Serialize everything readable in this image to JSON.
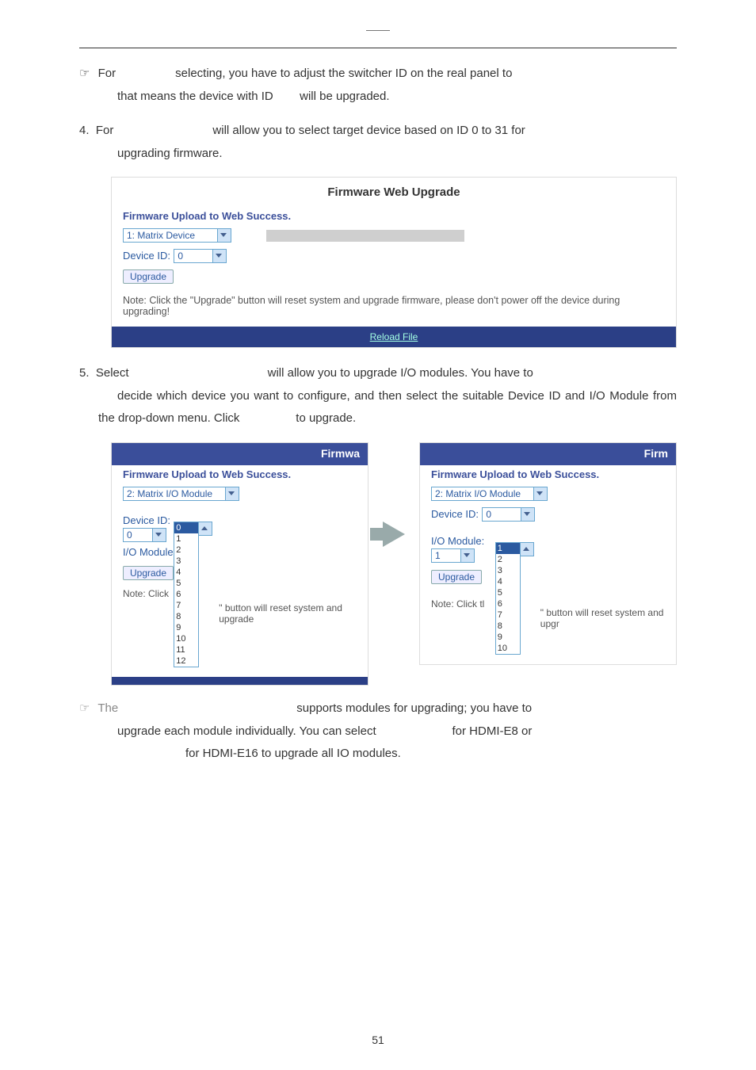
{
  "para1": {
    "hand": "☞",
    "lead": "For",
    "body": "selecting, you have to adjust the switcher ID on the real panel to",
    "line2_a": "that means the device with ID",
    "line2_b": "will be upgraded."
  },
  "item4": {
    "num": "4.",
    "lead": "For",
    "body": "will allow you to select target device based on ID 0 to 31 for",
    "line2": "upgrading firmware."
  },
  "panel1": {
    "title": "Firmware Web Upgrade",
    "success": "Firmware Upload to Web Success.",
    "select": "1: Matrix Device",
    "devLabel": "Device ID:",
    "devVal": "0",
    "upgrade": "Upgrade",
    "note": "Note: Click the \"Upgrade\" button will reset system and upgrade firmware, please don't power off the device during upgrading!",
    "reload": "Reload File"
  },
  "item5": {
    "num": "5.",
    "lead": "Select",
    "body": "will allow you to upgrade I/O modules. You have to",
    "line2": "decide which device you want to configure, and then select the suitable Device ID and I/O Module from the drop-down menu. Click",
    "line2b": "to upgrade."
  },
  "twinL": {
    "head": "Firmwa",
    "success": "Firmware Upload to Web Success.",
    "select": "2: Matrix I/O Module",
    "devLbl": "Device ID:",
    "devVal": "0",
    "ioLbl": "I/O Module",
    "upgrade": "Upgrade",
    "noteLead": "Note: Click",
    "noteTail": "\" button will reset system and upgrade",
    "opts": [
      "0",
      "1",
      "2",
      "3",
      "4",
      "5",
      "6",
      "7",
      "8",
      "9",
      "10",
      "11",
      "12"
    ]
  },
  "twinR": {
    "head": "Firm",
    "success": "Firmware Upload to Web Success.",
    "select": "2: Matrix I/O Module",
    "devLbl": "Device ID:",
    "devVal": "0",
    "ioLbl": "I/O Module:",
    "ioVal": "1",
    "upgrade": "Upgrade",
    "noteLead": "Note: Click tl",
    "noteTail": "\" button will reset system and upgr",
    "opts": [
      "1",
      "2",
      "3",
      "4",
      "5",
      "6",
      "7",
      "8",
      "9",
      "10"
    ]
  },
  "para2": {
    "hand": "☞",
    "lead": "The",
    "body": "supports modules for upgrading; you have to",
    "line2a": "upgrade each module individually. You can select",
    "line2b": "for HDMI-E8 or",
    "line3": "for HDMI-E16 to upgrade all IO modules."
  },
  "pg": "51"
}
